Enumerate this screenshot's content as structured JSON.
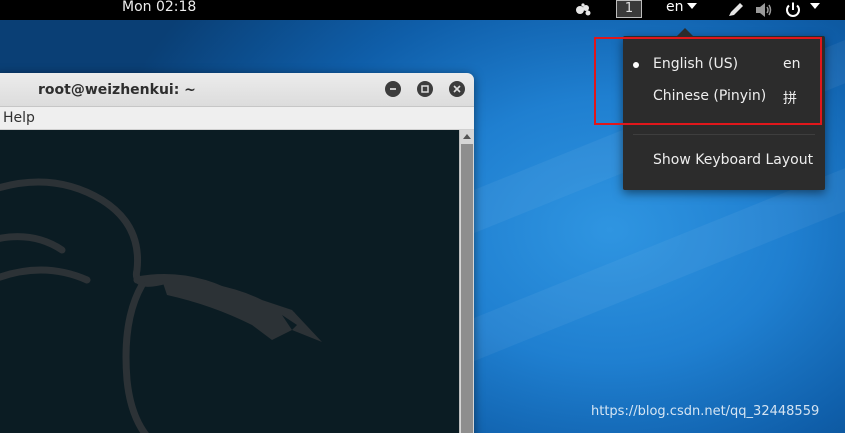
{
  "top_panel": {
    "clock": "Mon 02:18",
    "workspace_number": "1",
    "keyboard_indicator": "en",
    "icons": [
      "gnome-extension-icon",
      "pen-icon",
      "volume-icon",
      "power-icon"
    ]
  },
  "terminal": {
    "title": "root@weizhenkui: ~",
    "menu": [
      "Help"
    ],
    "background_color": "#0b1c23"
  },
  "keyboard_menu": {
    "items": [
      {
        "label": "English (US)",
        "code": "en",
        "selected": true
      },
      {
        "label": "Chinese (Pinyin)",
        "code": "拼",
        "selected": false
      }
    ],
    "show_layout_label": "Show Keyboard Layout"
  },
  "annotation": {
    "color": "#e0171b"
  },
  "watermark": "https://blog.csdn.net/qq_32448559"
}
